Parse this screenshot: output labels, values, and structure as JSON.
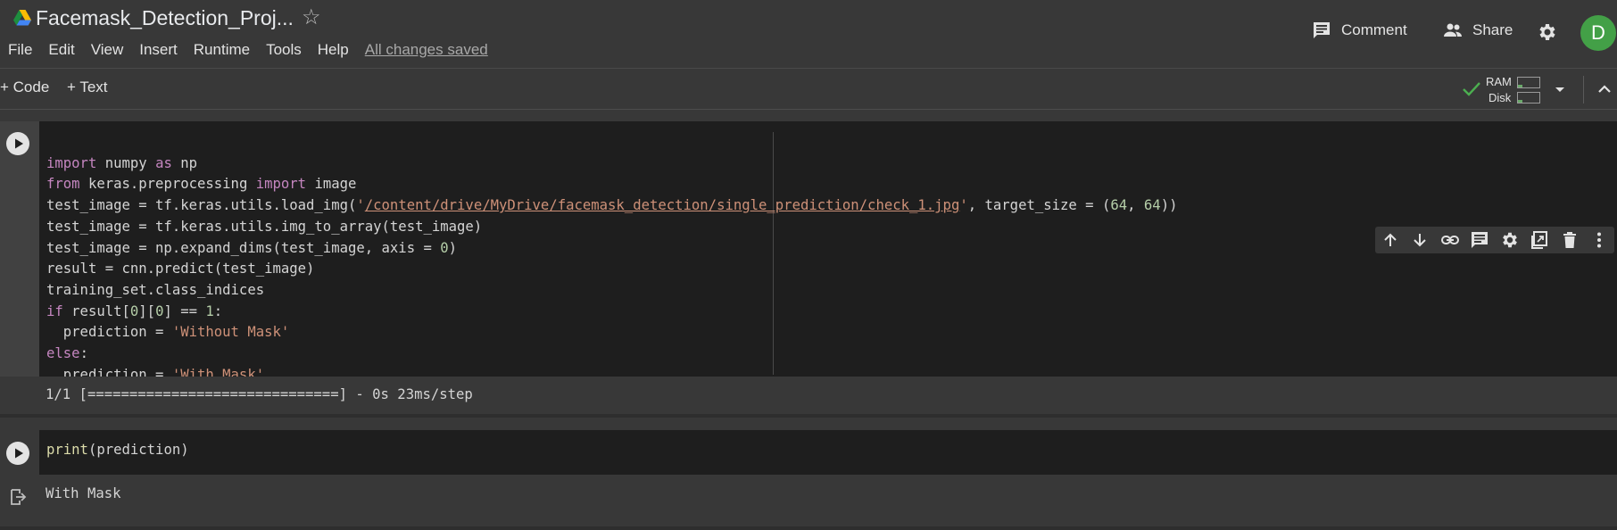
{
  "header": {
    "title": "Facemask_Detection_Proj...",
    "menu": [
      "File",
      "Edit",
      "View",
      "Insert",
      "Runtime",
      "Tools",
      "Help"
    ],
    "saved_status": "All changes saved",
    "comment_label": "Comment",
    "share_label": "Share",
    "avatar_letter": "D",
    "avatar_color": "#43a047"
  },
  "toolbar": {
    "add_code_label": "+ Code",
    "add_text_label": "+ Text",
    "ram_label": "RAM",
    "disk_label": "Disk",
    "status_icon": "check-icon",
    "ram_usage_fraction": 0.2,
    "disk_usage_fraction": 0.2
  },
  "cells": [
    {
      "type": "code",
      "code_lines": [
        "import numpy as np",
        "from keras.preprocessing import image",
        "test_image = tf.keras.utils.load_img('/content/drive/MyDrive/facemask_detection/single_prediction/check_1.jpg', target_size = (64, 64))",
        "test_image = tf.keras.utils.img_to_array(test_image)",
        "test_image = np.expand_dims(test_image, axis = 0)",
        "result = cnn.predict(test_image)",
        "training_set.class_indices",
        "if result[0][0] == 1:",
        "  prediction = 'Without Mask'",
        "else:",
        "  prediction = 'With Mask'"
      ],
      "output": "1/1 [==============================] - 0s 23ms/step"
    },
    {
      "type": "code",
      "code_lines": [
        "print(prediction)"
      ],
      "output": "With Mask"
    }
  ],
  "cell_toolbar_icons": [
    "arrow-up-icon",
    "arrow-down-icon",
    "link-icon",
    "comment-icon",
    "gear-icon",
    "mirror-cell-icon",
    "trash-icon",
    "more-vert-icon"
  ],
  "colors": {
    "keyword": "#c586c0",
    "string": "#ce9178",
    "number": "#b5cea8",
    "function": "#dcdcaa"
  }
}
